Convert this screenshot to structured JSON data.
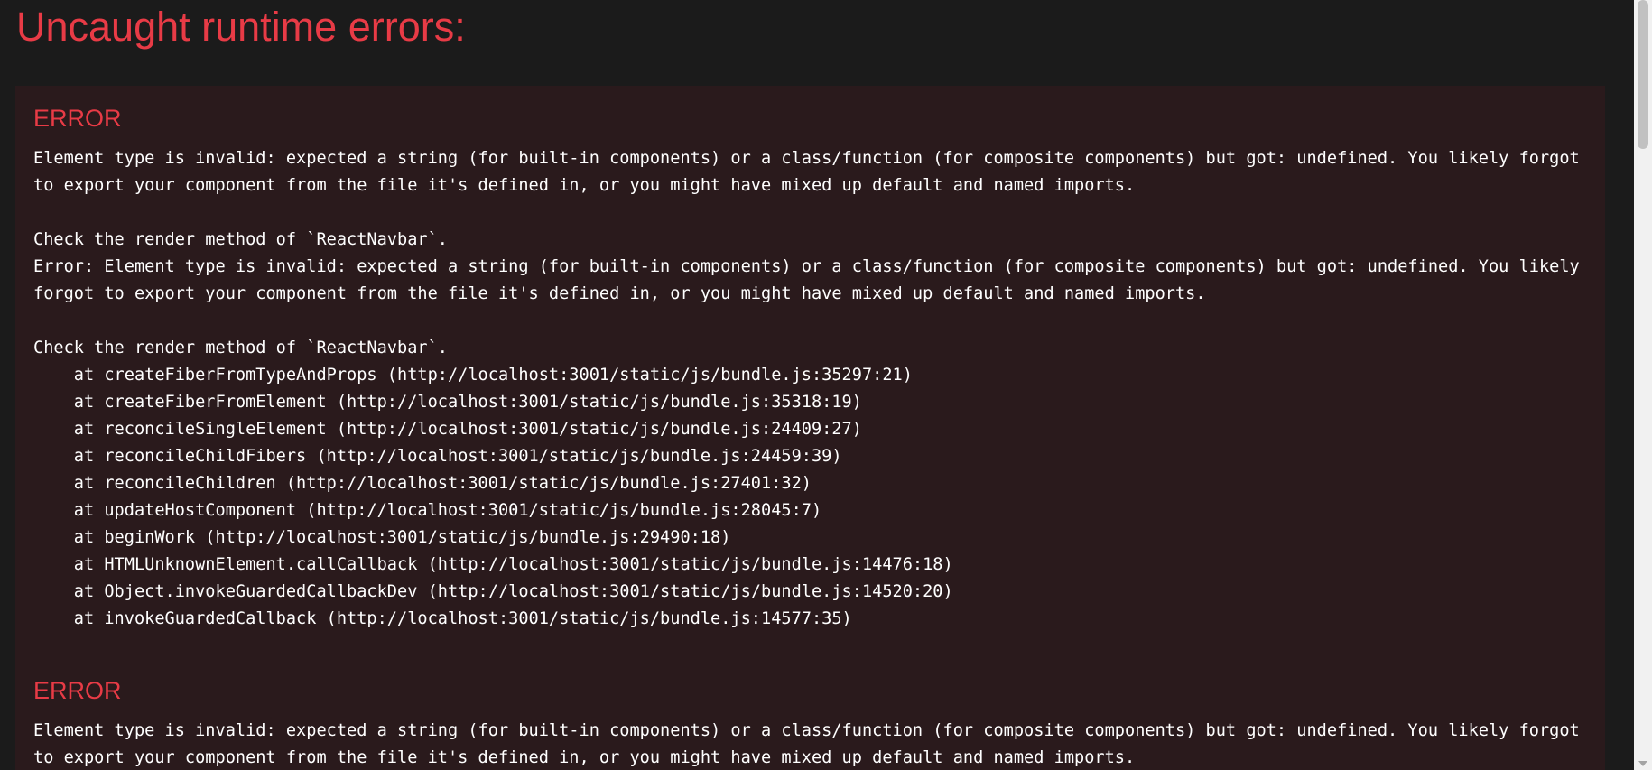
{
  "header": {
    "title": "Uncaught runtime errors:"
  },
  "errors": [
    {
      "title": "ERROR",
      "message": "Element type is invalid: expected a string (for built-in components) or a class/function (for composite components) but got: undefined. You likely forgot to export your component from the file it's defined in, or you might have mixed up default and named imports.\n\nCheck the render method of `ReactNavbar`.\nError: Element type is invalid: expected a string (for built-in components) or a class/function (for composite components) but got: undefined. You likely forgot to export your component from the file it's defined in, or you might have mixed up default and named imports.\n\nCheck the render method of `ReactNavbar`.\n    at createFiberFromTypeAndProps (http://localhost:3001/static/js/bundle.js:35297:21)\n    at createFiberFromElement (http://localhost:3001/static/js/bundle.js:35318:19)\n    at reconcileSingleElement (http://localhost:3001/static/js/bundle.js:24409:27)\n    at reconcileChildFibers (http://localhost:3001/static/js/bundle.js:24459:39)\n    at reconcileChildren (http://localhost:3001/static/js/bundle.js:27401:32)\n    at updateHostComponent (http://localhost:3001/static/js/bundle.js:28045:7)\n    at beginWork (http://localhost:3001/static/js/bundle.js:29490:18)\n    at HTMLUnknownElement.callCallback (http://localhost:3001/static/js/bundle.js:14476:18)\n    at Object.invokeGuardedCallbackDev (http://localhost:3001/static/js/bundle.js:14520:20)\n    at invokeGuardedCallback (http://localhost:3001/static/js/bundle.js:14577:35)"
    },
    {
      "title": "ERROR",
      "message": "Element type is invalid: expected a string (for built-in components) or a class/function (for composite components) but got: undefined. You likely forgot to export your component from the file it's defined in, or you might have mixed up default and named imports."
    }
  ],
  "colors": {
    "background": "#1b1b1b",
    "card_background": "#2a1a1c",
    "error_red": "#e83b46",
    "text": "#ffffff"
  }
}
